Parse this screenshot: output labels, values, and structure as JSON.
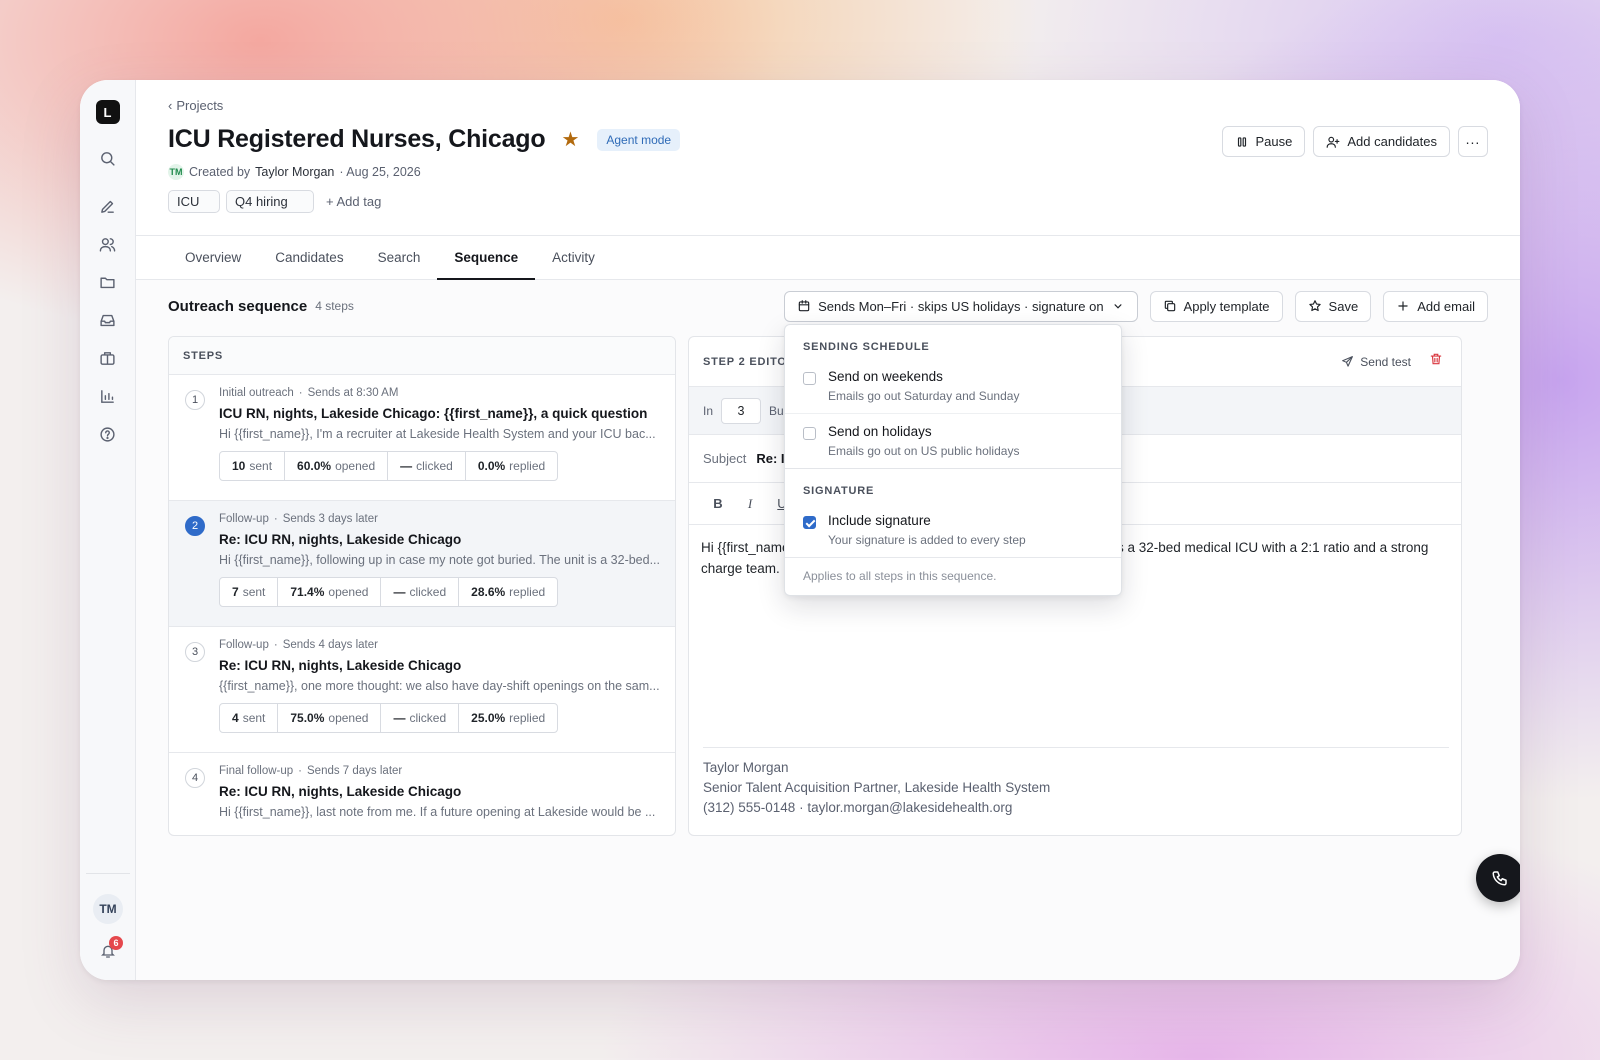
{
  "sidebar": {
    "logo": "L",
    "user_initials": "TM",
    "notification_count": "6"
  },
  "header": {
    "breadcrumb": "Projects",
    "title": "ICU Registered Nurses, Chicago",
    "badge": "Agent mode",
    "created_prefix": "Created by",
    "author": "Taylor Morgan",
    "author_initials": "TM",
    "date": "· Aug 25, 2026",
    "tags": [
      "ICU",
      "Q4 hiring"
    ],
    "add_tag": "Add tag",
    "actions": {
      "pause": "Pause",
      "add_candidates": "Add candidates"
    }
  },
  "tabs": [
    "Overview",
    "Candidates",
    "Search",
    "Sequence",
    "Activity"
  ],
  "active_tab": "Sequence",
  "toolbar": {
    "title": "Outreach sequence",
    "count": "4 steps",
    "schedule": "Sends Mon–Fri · skips US holidays · signature on",
    "apply_template": "Apply template",
    "save": "Save",
    "add_email": "Add email"
  },
  "steps_panel": {
    "heading": "STEPS",
    "steps": [
      {
        "num": "1",
        "type": "Initial outreach",
        "timing": "Sends at 8:30 AM",
        "subject": "ICU RN, nights, Lakeside Chicago: {{first_name}}, a quick question",
        "preview": "Hi {{first_name}}, I'm a recruiter at Lakeside Health System and your ICU bac...",
        "sent": "10",
        "opened": "60.0%",
        "clicked": "—",
        "replied": "0.0%"
      },
      {
        "num": "2",
        "type": "Follow-up",
        "timing": "Sends 3 days later",
        "subject": "Re: ICU RN, nights, Lakeside Chicago",
        "preview": "Hi {{first_name}}, following up in case my note got buried. The unit is a 32-bed...",
        "sent": "7",
        "opened": "71.4%",
        "clicked": "—",
        "replied": "28.6%"
      },
      {
        "num": "3",
        "type": "Follow-up",
        "timing": "Sends 4 days later",
        "subject": "Re: ICU RN, nights, Lakeside Chicago",
        "preview": "{{first_name}}, one more thought: we also have day-shift openings on the sam...",
        "sent": "4",
        "opened": "75.0%",
        "clicked": "—",
        "replied": "25.0%"
      },
      {
        "num": "4",
        "type": "Final follow-up",
        "timing": "Sends 7 days later",
        "subject": "Re: ICU RN, nights, Lakeside Chicago",
        "preview": "Hi {{first_name}}, last note from me. If a future opening at Lakeside would be ...",
        "sent": "",
        "opened": "",
        "clicked": "",
        "replied": ""
      }
    ],
    "labels": {
      "sent": "sent",
      "opened": "opened",
      "clicked": "clicked",
      "replied": "replied"
    }
  },
  "editor": {
    "heading": "STEP 2 EDITOR",
    "send_test": "Send test",
    "delay_prefix": "In",
    "delay_value": "3",
    "delay_unit": "Bus",
    "subject_label": "Subject",
    "subject_value": "Re: IC",
    "format": [
      "B",
      "I",
      "U"
    ],
    "body": "Hi {{first_name",
    "body_tail": "s a 32-bed medical ICU with a 2:1 ratio and a strong",
    "body_line2": "charge team. I",
    "signature": {
      "name": "Taylor Morgan",
      "title": "Senior Talent Acquisition Partner, Lakeside Health System",
      "contact": "(312) 555-0148 · taylor.morgan@lakesidehealth.org"
    }
  },
  "dropdown": {
    "schedule_title": "SENDING SCHEDULE",
    "weekends_label": "Send on weekends",
    "weekends_desc": "Emails go out Saturday and Sunday",
    "weekends_checked": false,
    "holidays_label": "Send on holidays",
    "holidays_desc": "Emails go out on US public holidays",
    "holidays_checked": false,
    "signature_title": "SIGNATURE",
    "signature_label": "Include signature",
    "signature_desc": "Your signature is added to every step",
    "signature_checked": true,
    "footer": "Applies to all steps in this sequence."
  },
  "colors": {
    "accent": "#2f6bc9",
    "star": "#b26a0e",
    "danger": "#d9363e",
    "badge_bg": "#e6f0fb"
  }
}
